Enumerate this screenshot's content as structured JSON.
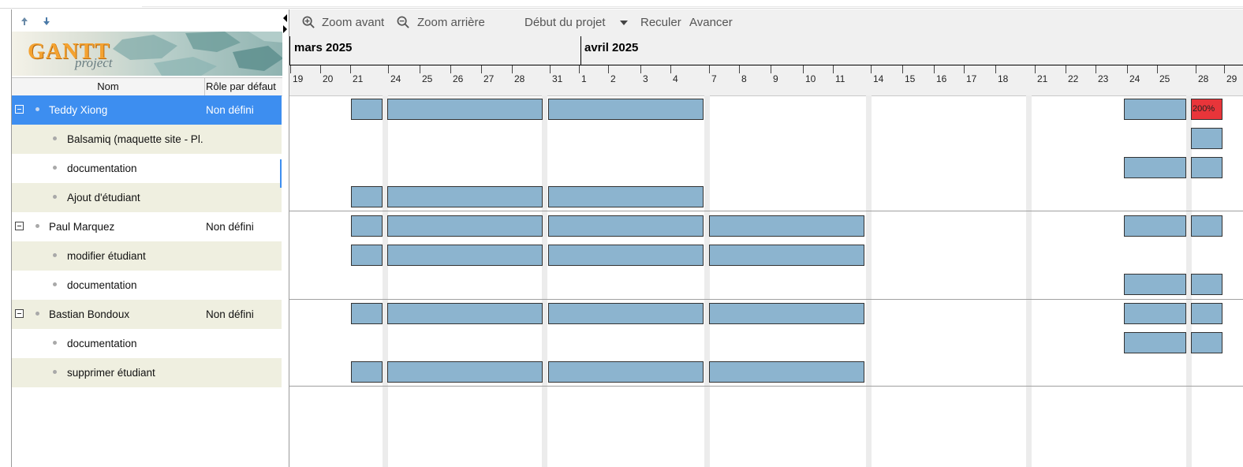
{
  "left_panel": {
    "logo": {
      "main": "GANTT",
      "sub": "project"
    },
    "columns": {
      "name": "Nom",
      "role": "Rôle par défaut"
    },
    "rows": [
      {
        "name": "Teddy Xiong",
        "role": "Non défini",
        "type": "resource"
      },
      {
        "name": "Balsamiq (maquette site - Pl.",
        "role": "",
        "type": "task"
      },
      {
        "name": "documentation",
        "role": "",
        "type": "task"
      },
      {
        "name": "Ajout d'étudiant",
        "role": "",
        "type": "task"
      },
      {
        "name": "Paul Marquez",
        "role": "Non défini",
        "type": "resource"
      },
      {
        "name": "modifier étudiant",
        "role": "",
        "type": "task"
      },
      {
        "name": "documentation",
        "role": "",
        "type": "task"
      },
      {
        "name": "Bastian Bondoux",
        "role": "Non défini",
        "type": "resource"
      },
      {
        "name": "documentation",
        "role": "",
        "type": "task"
      },
      {
        "name": "supprimer étudiant",
        "role": "",
        "type": "task"
      }
    ]
  },
  "toolbar": {
    "zoom_in": "Zoom avant",
    "zoom_out": "Zoom arrière",
    "project_start": "Début du projet",
    "back": "Reculer",
    "forward": "Avancer"
  },
  "timeline": {
    "months": [
      "mars 2025",
      "avril 2025"
    ],
    "days": [
      "19",
      "20",
      "21",
      "24",
      "25",
      "26",
      "27",
      "28",
      "31",
      "1",
      "2",
      "3",
      "4",
      "7",
      "8",
      "9",
      "10",
      "11",
      "14",
      "15",
      "16",
      "17",
      "18",
      "21",
      "22",
      "23",
      "24",
      "25",
      "28",
      "29"
    ]
  },
  "overload_label": "200%",
  "colors": {
    "bar": "#8cb4cf",
    "overload": "#e8353a",
    "selection": "#3d8ef0",
    "alt_row": "#efefe0"
  }
}
